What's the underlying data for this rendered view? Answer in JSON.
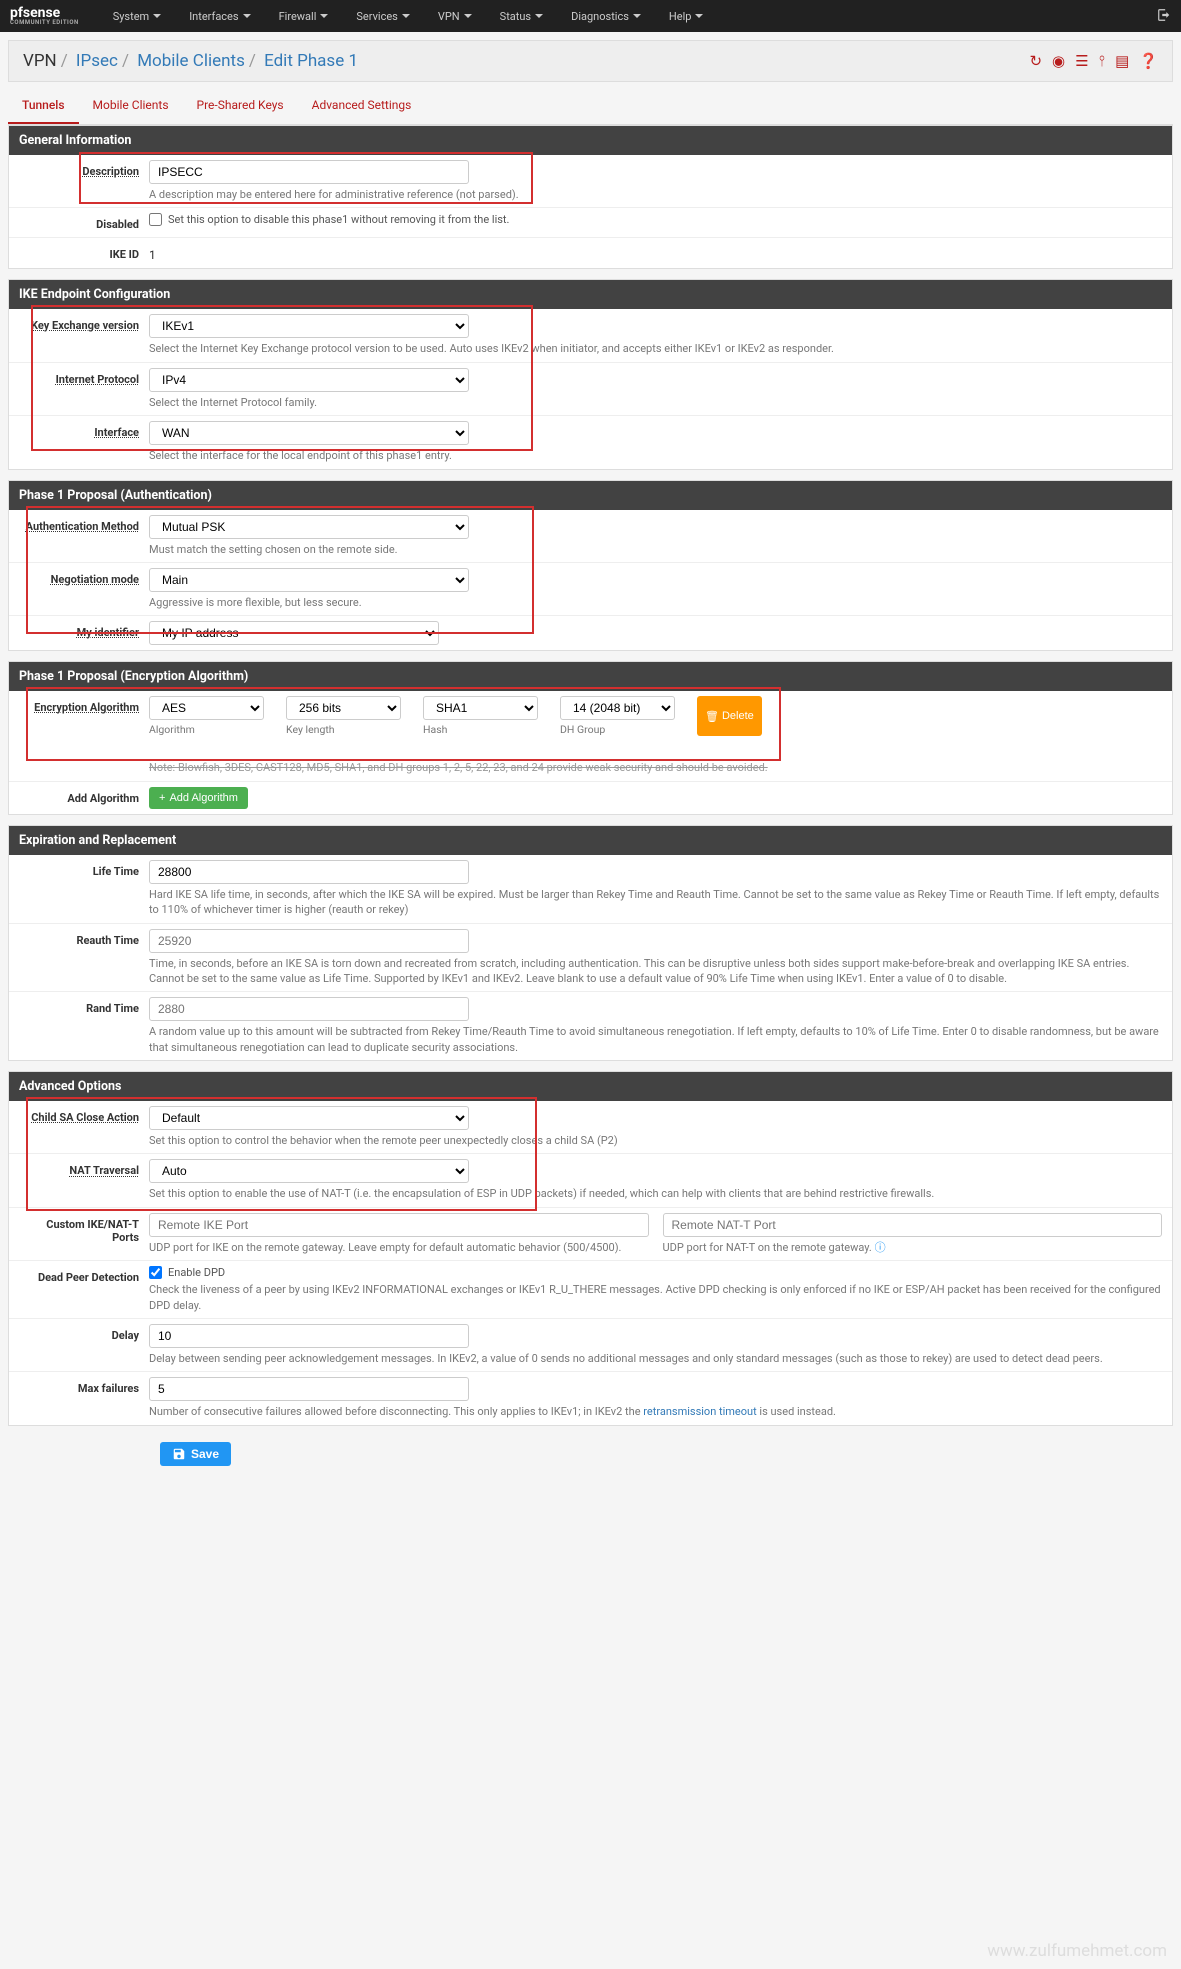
{
  "nav": {
    "logo": "pfsense",
    "logo_sub": "COMMUNITY EDITION",
    "items": [
      "System",
      "Interfaces",
      "Firewall",
      "Services",
      "VPN",
      "Status",
      "Diagnostics",
      "Help"
    ]
  },
  "breadcrumb": {
    "p0": "VPN",
    "p1": "IPsec",
    "p2": "Mobile Clients",
    "p3": "Edit Phase 1"
  },
  "tabs": [
    "Tunnels",
    "Mobile Clients",
    "Pre-Shared Keys",
    "Advanced Settings"
  ],
  "sections": {
    "general": {
      "title": "General Information",
      "description_label": "Description",
      "description_value": "IPSECC",
      "description_help": "A description may be entered here for administrative reference (not parsed).",
      "disabled_label": "Disabled",
      "disabled_help": "Set this option to disable this phase1 without removing it from the list.",
      "ikeid_label": "IKE ID",
      "ikeid_value": "1"
    },
    "endpoint": {
      "title": "IKE Endpoint Configuration",
      "kex_label": "Key Exchange version",
      "kex_value": "IKEv1",
      "kex_help": "Select the Internet Key Exchange protocol version to be used. Auto uses IKEv2 when initiator, and accepts either IKEv1 or IKEv2 as responder.",
      "ip_label": "Internet Protocol",
      "ip_value": "IPv4",
      "ip_help": "Select the Internet Protocol family.",
      "iface_label": "Interface",
      "iface_value": "WAN",
      "iface_help": "Select the interface for the local endpoint of this phase1 entry."
    },
    "auth": {
      "title": "Phase 1 Proposal (Authentication)",
      "method_label": "Authentication Method",
      "method_value": "Mutual PSK",
      "method_help": "Must match the setting chosen on the remote side.",
      "mode_label": "Negotiation mode",
      "mode_value": "Main",
      "mode_help": "Aggressive is more flexible, but less secure.",
      "myid_label": "My identifier",
      "myid_value": "My IP address"
    },
    "enc": {
      "title": "Phase 1 Proposal (Encryption Algorithm)",
      "label": "Encryption Algorithm",
      "algo": "AES",
      "keylen": "256 bits",
      "hash": "SHA1",
      "dh": "14 (2048 bit)",
      "sub_algo": "Algorithm",
      "sub_keylen": "Key length",
      "sub_hash": "Hash",
      "sub_dh": "DH Group",
      "delete": "Delete",
      "note": "Note: Blowfish, 3DES, CAST128, MD5, SHA1, and DH groups 1, 2, 5, 22, 23, and 24 provide weak security and should be avoided.",
      "add_label": "Add Algorithm",
      "add_btn": "Add Algorithm"
    },
    "expiry": {
      "title": "Expiration and Replacement",
      "life_label": "Life Time",
      "life_value": "28800",
      "life_help": "Hard IKE SA life time, in seconds, after which the IKE SA will be expired. Must be larger than Rekey Time and Reauth Time. Cannot be set to the same value as Rekey Time or Reauth Time. If left empty, defaults to 110% of whichever timer is higher (reauth or rekey)",
      "reauth_label": "Reauth Time",
      "reauth_ph": "25920",
      "reauth_help": "Time, in seconds, before an IKE SA is torn down and recreated from scratch, including authentication. This can be disruptive unless both sides support make-before-break and overlapping IKE SA entries. Cannot be set to the same value as Life Time. Supported by IKEv1 and IKEv2. Leave blank to use a default value of 90% Life Time when using IKEv1. Enter a value of 0 to disable.",
      "rand_label": "Rand Time",
      "rand_ph": "2880",
      "rand_help": "A random value up to this amount will be subtracted from Rekey Time/Reauth Time to avoid simultaneous renegotiation. If left empty, defaults to 10% of Life Time. Enter 0 to disable randomness, but be aware that simultaneous renegotiation can lead to duplicate security associations."
    },
    "adv": {
      "title": "Advanced Options",
      "child_label": "Child SA Close Action",
      "child_value": "Default",
      "child_help": "Set this option to control the behavior when the remote peer unexpectedly closes a child SA (P2)",
      "nat_label": "NAT Traversal",
      "nat_value": "Auto",
      "nat_help": "Set this option to enable the use of NAT-T (i.e. the encapsulation of ESP in UDP packets) if needed, which can help with clients that are behind restrictive firewalls.",
      "ports_label": "Custom IKE/NAT-T Ports",
      "ike_ph": "Remote IKE Port",
      "ike_help": "UDP port for IKE on the remote gateway. Leave empty for default automatic behavior (500/4500).",
      "natport_ph": "Remote NAT-T Port",
      "natport_help": "UDP port for NAT-T on the remote gateway.",
      "dpd_label": "Dead Peer Detection",
      "dpd_cb": "Enable DPD",
      "dpd_help": "Check the liveness of a peer by using IKEv2 INFORMATIONAL exchanges or IKEv1 R_U_THERE messages. Active DPD checking is only enforced if no IKE or ESP/AH packet has been received for the configured DPD delay.",
      "delay_label": "Delay",
      "delay_value": "10",
      "delay_help": "Delay between sending peer acknowledgement messages. In IKEv2, a value of 0 sends no additional messages and only standard messages (such as those to rekey) are used to detect dead peers.",
      "maxf_label": "Max failures",
      "maxf_value": "5",
      "maxf_help_1": "Number of consecutive failures allowed before disconnecting. This only applies to IKEv1; in IKEv2 the ",
      "maxf_link": "retransmission timeout",
      "maxf_help_2": " is used instead."
    }
  },
  "save": "Save",
  "watermark": "www.zulfumehmet.com"
}
